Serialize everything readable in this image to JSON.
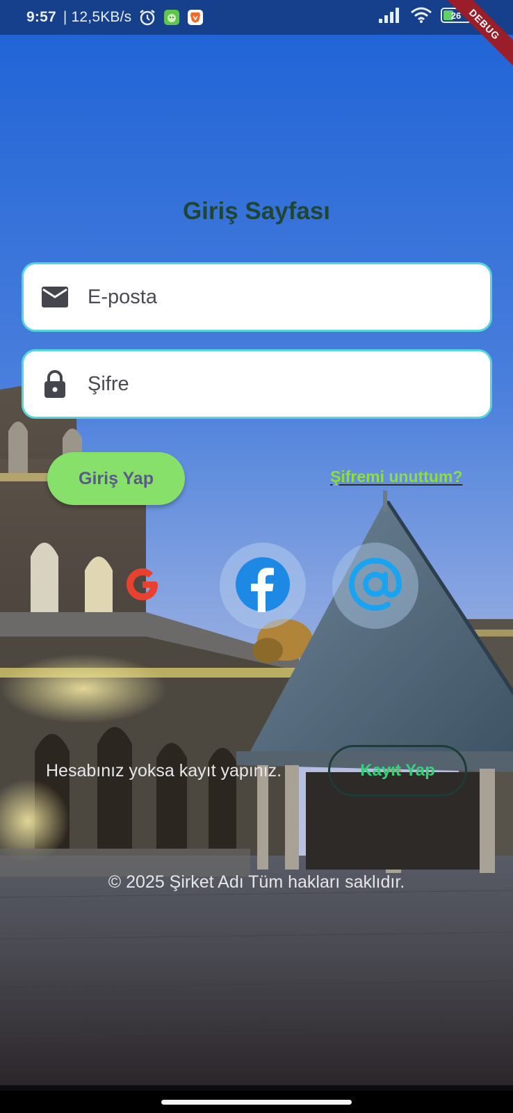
{
  "status_bar": {
    "time": "9:57",
    "network_speed": "| 12,5KB/s",
    "battery_level": "26",
    "debug_label": "DEBUG",
    "icons": [
      "alarm-icon",
      "android-app-icon",
      "brave-icon",
      "signal-icon",
      "wifi-icon",
      "battery-icon"
    ]
  },
  "login": {
    "title": "Giriş Sayfası",
    "email_placeholder": "E-posta",
    "password_placeholder": "Şifre",
    "login_button": "Giriş Yap",
    "forgot_password": "Şifremi unuttum?"
  },
  "social": {
    "google_letter": "G",
    "icons": [
      "google-icon",
      "facebook-icon",
      "at-sign-icon"
    ]
  },
  "register": {
    "prompt": "Hesabınız yoksa kayıt yapınız.",
    "button": "Kayıt Yap"
  },
  "footer": {
    "copyright": "© 2025 Şirket Adı Tüm hakları saklıdır."
  },
  "colors": {
    "status_bar": "#16408c",
    "title": "#1f4634",
    "field_border": "#55d6dc",
    "login_button": "#86e06a",
    "forgot_link": "#8ede3c",
    "register_text": "#34d17a",
    "google": "#e8412f",
    "facebook": "#1e88e5",
    "email_at": "#1aa3f0"
  }
}
